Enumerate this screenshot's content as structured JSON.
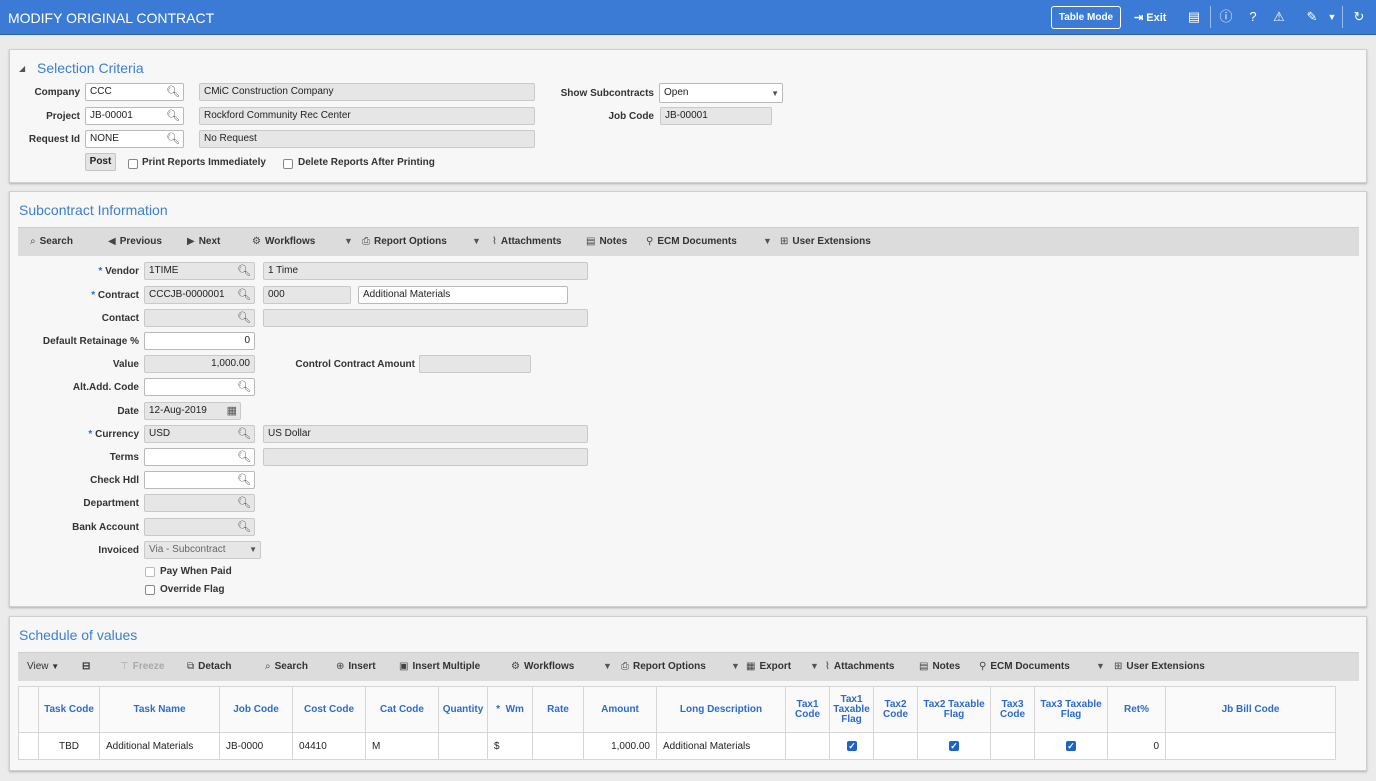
{
  "window": {
    "title": "MODIFY ORIGINAL CONTRACT",
    "table_mode": "Table Mode",
    "exit": "Exit"
  },
  "selection": {
    "title": "Selection Criteria",
    "company_label": "Company",
    "company_value": "CCC",
    "company_name": "CMiC Construction Company",
    "project_label": "Project",
    "project_value": "JB-00001",
    "project_name": "Rockford Community Rec Center",
    "request_label": "Request Id",
    "request_value": "NONE",
    "request_name": "No Request",
    "show_sub_label": "Show Subcontracts",
    "show_sub_value": "Open",
    "job_code_label": "Job Code",
    "job_code_value": "JB-00001",
    "post": "Post",
    "print_reports": "Print Reports Immediately",
    "delete_reports": "Delete Reports After Printing"
  },
  "subcontract": {
    "title": "Subcontract Information",
    "toolbar": {
      "search": "Search",
      "previous": "Previous",
      "next": "Next",
      "workflows": "Workflows",
      "report_options": "Report Options",
      "attachments": "Attachments",
      "notes": "Notes",
      "ecm": "ECM Documents",
      "user_ext": "User Extensions"
    },
    "required_mark": "*",
    "vendor_label": "Vendor",
    "vendor_value": "1TIME",
    "vendor_name": "1 Time",
    "contract_label": "Contract",
    "contract_value": "CCCJB-0000001",
    "contract_suffix": "000",
    "contract_desc": "Additional Materials",
    "contact_label": "Contact",
    "retainage_label": "Default Retainage %",
    "retainage_value": "0",
    "value_label": "Value",
    "value_value": "1,000.00",
    "control_amount_label": "Control Contract Amount",
    "alt_add_label": "Alt.Add. Code",
    "date_label": "Date",
    "date_value": "12-Aug-2019",
    "currency_label": "Currency",
    "currency_value": "USD",
    "currency_name": "US Dollar",
    "terms_label": "Terms",
    "check_hdl_label": "Check Hdl",
    "department_label": "Department",
    "bank_label": "Bank Account",
    "invoiced_label": "Invoiced",
    "invoiced_value": "Via - Subcontract",
    "pay_when_paid": "Pay When Paid",
    "override_flag": "Override Flag"
  },
  "schedule": {
    "title": "Schedule of values",
    "toolbar": {
      "view": "View",
      "freeze": "Freeze",
      "detach": "Detach",
      "search": "Search",
      "insert": "Insert",
      "insert_multiple": "Insert Multiple",
      "workflows": "Workflows",
      "report_options": "Report Options",
      "export": "Export",
      "attachments": "Attachments",
      "notes": "Notes",
      "ecm": "ECM Documents",
      "user_ext": "User Extensions"
    },
    "columns": {
      "task_code": "Task Code",
      "task_name": "Task Name",
      "job_code": "Job Code",
      "cost_code": "Cost Code",
      "cat_code": "Cat Code",
      "quantity": "Quantity",
      "wm": "Wm",
      "rate": "Rate",
      "amount": "Amount",
      "long_desc": "Long Description",
      "tax1_code": "Tax1 Code",
      "tax1_flag": "Tax1 Taxable Flag",
      "tax2_code": "Tax2 Code",
      "tax2_flag": "Tax2 Taxable Flag",
      "tax3_code": "Tax3 Code",
      "tax3_flag": "Tax3 Taxable Flag",
      "ret": "Ret%",
      "jb_bill": "Jb Bill Code"
    },
    "row": {
      "task_code": "TBD",
      "task_name": "Additional Materials",
      "job_code": "JB-0000",
      "cost_code": "04410",
      "cat_code": "M",
      "quantity": "",
      "wm": "$",
      "rate": "",
      "amount": "1,000.00",
      "long_desc": "Additional Materials",
      "tax1_code": "",
      "tax1_flag": true,
      "tax2_code": "",
      "tax2_flag": true,
      "tax3_code": "",
      "tax3_flag": true,
      "ret": "0",
      "jb_bill": ""
    }
  }
}
